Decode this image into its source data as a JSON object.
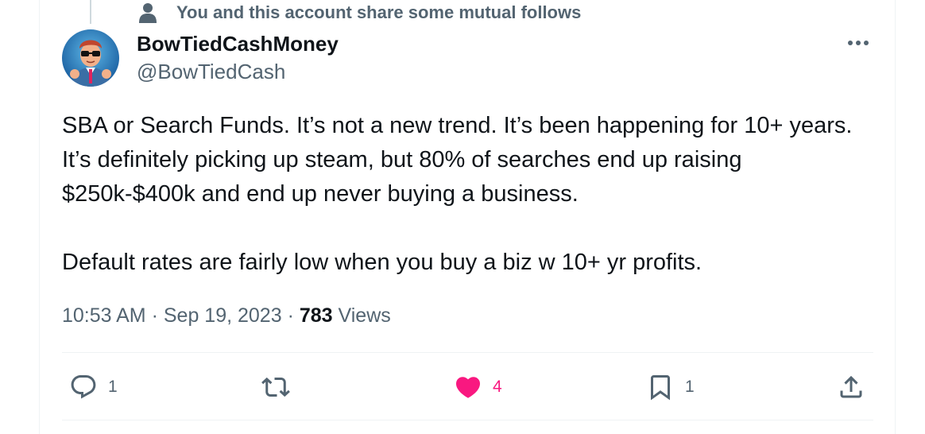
{
  "social_context": {
    "text": "You and this account share some mutual follows",
    "icon": "person-icon"
  },
  "author": {
    "display_name": "BowTiedCashMoney",
    "handle": "@BowTiedCash",
    "avatar": "avatar-illustration"
  },
  "tweet": {
    "paragraphs": [
      "SBA or Search Funds. It’s not a new trend. It’s been happening for 10+ years. It’s definitely picking up steam, but 80% of searches end up raising $250k-$400k and end up never buying a business.",
      "Default rates are fairly low when you buy a biz w 10+ yr profits."
    ]
  },
  "meta": {
    "time": "10:53 AM",
    "separator": "·",
    "date": "Sep 19, 2023",
    "views_count": "783",
    "views_label": "Views"
  },
  "actions": {
    "reply": {
      "icon": "reply-icon",
      "count": "1"
    },
    "retweet": {
      "icon": "retweet-icon",
      "count": ""
    },
    "like": {
      "icon": "heart-icon",
      "count": "4",
      "active": true
    },
    "bookmark": {
      "icon": "bookmark-icon",
      "count": "1"
    },
    "share": {
      "icon": "share-icon",
      "count": ""
    }
  },
  "colors": {
    "text_primary": "#0f1419",
    "text_secondary": "#536471",
    "like_active": "#f91880",
    "divider": "#eff3f4"
  }
}
